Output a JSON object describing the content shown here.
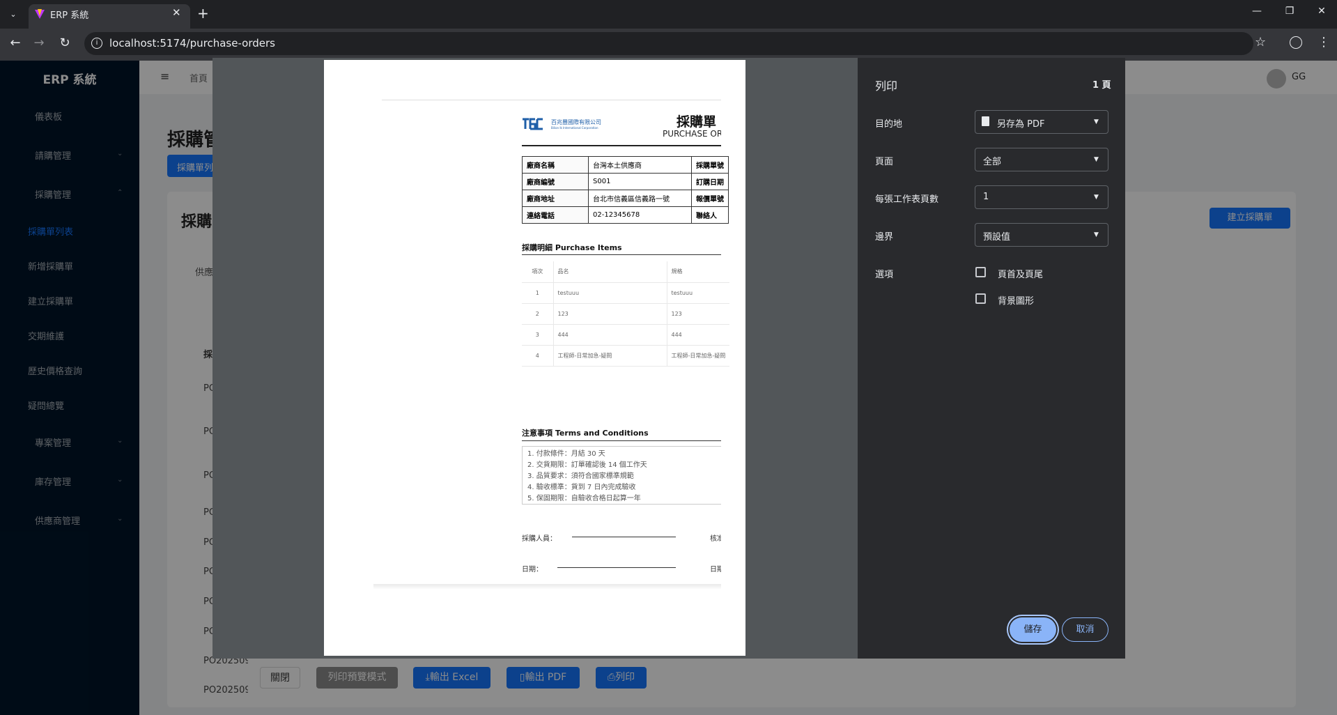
{
  "browser": {
    "tab_title": "ERP 系統",
    "url": "localhost:5174/purchase-orders"
  },
  "app": {
    "logo": "ERP 系統",
    "breadcrumb": "首頁",
    "user": "GG",
    "page_title": "採購管",
    "blue_tab": "採購單列表",
    "card_title": "採購",
    "create_button": "建立採購單",
    "filter_label": "供應",
    "table_header": "採",
    "sidebar": {
      "dashboard": "儀表板",
      "request_mgmt": "請購管理",
      "purchase_mgmt": "採購管理",
      "po_list": "採購單列表",
      "new_po": "新增採購單",
      "create_po": "建立採購單",
      "delivery": "交期維護",
      "price_history": "歷史價格查詢",
      "faq": "疑問總覽",
      "project_mgmt": "專案管理",
      "inventory_mgmt": "庫存管理",
      "supplier_mgmt": "供應商管理"
    },
    "po_rows": [
      "PO",
      "PO",
      "PO",
      "PO",
      "PO",
      "PO",
      "PO",
      "PO",
      "PO202509",
      "PO202509"
    ],
    "bottom_buttons": {
      "close": "關閉",
      "print_preview": "列印預覽模式",
      "export_excel": "輸出 Excel",
      "export_pdf": "輸出 PDF",
      "print": "列印"
    }
  },
  "print_dialog": {
    "title": "列印",
    "page_count": "1 頁",
    "destination_label": "目的地",
    "destination_value": "另存為 PDF",
    "pages_label": "頁面",
    "pages_value": "全部",
    "pages_per_sheet_label": "每張工作表頁數",
    "pages_per_sheet_value": "1",
    "margins_label": "邊界",
    "margins_value": "預設值",
    "options_label": "選項",
    "option_headers": "頁首及頁尾",
    "option_background": "背景圖形",
    "save": "儲存",
    "cancel": "取消"
  },
  "document": {
    "company_cn": "百兆豐國際有限公司",
    "company_en": "Bilion Ik International Corporation",
    "title": "採購單",
    "subtitle": "PURCHASE ORD",
    "info_rows": [
      {
        "label": "廠商名稱",
        "value": "台灣本土供應商",
        "label2": "採購單號"
      },
      {
        "label": "廠商編號",
        "value": "S001",
        "label2": "訂購日期"
      },
      {
        "label": "廠商地址",
        "value": "台北市信義區信義路一號",
        "label2": "報價單號"
      },
      {
        "label": "連絡電話",
        "value": "02-12345678",
        "label2": "聯絡人"
      }
    ],
    "items_title": "採購明細 Purchase Items",
    "items_header": [
      "項次",
      "品名",
      "規格"
    ],
    "items": [
      [
        "1",
        "testuuu",
        "testuuu"
      ],
      [
        "2",
        "123",
        "123"
      ],
      [
        "3",
        "444",
        "444"
      ],
      [
        "4",
        "工程師-日常加急-疑問",
        "工程師-日常加急-疑問"
      ]
    ],
    "terms_title": "注意事項 Terms and Conditions",
    "terms": [
      "1. 付款條件：月結 30 天",
      "2. 交貨期限：訂單確認後 14 個工作天",
      "3. 品質要求：須符合國家標準規範",
      "4. 驗收標準：貨到 7 日內完成驗收",
      "5. 保固期限：自驗收合格日起算一年"
    ],
    "sig_buyer": "採購人員：",
    "sig_approver": "核准",
    "sig_date": "日期：",
    "sig_date2": "日期"
  }
}
